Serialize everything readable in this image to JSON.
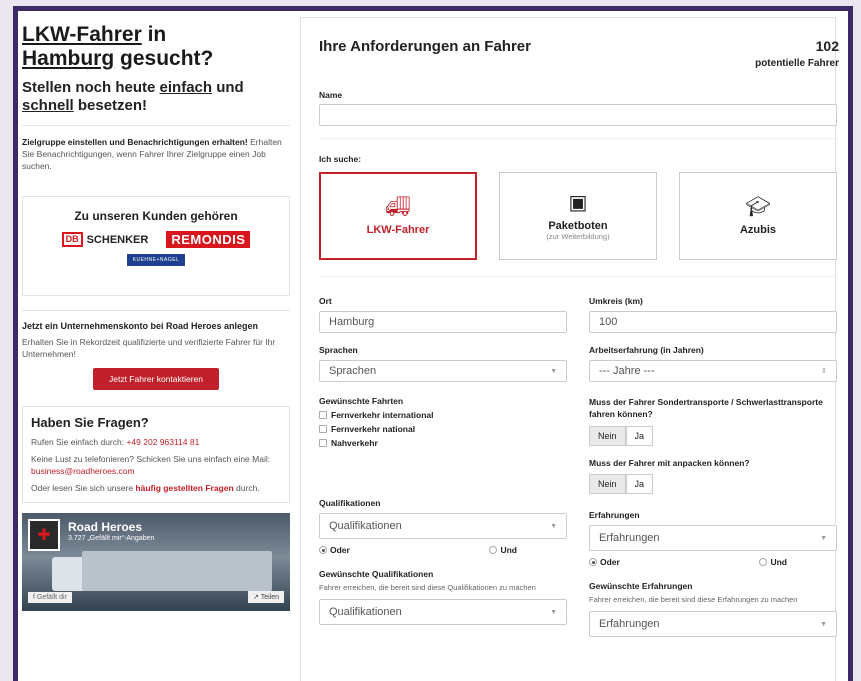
{
  "sidebar": {
    "title_part1": "LKW-Fahrer",
    "title_part2": " in",
    "title_part3": "Hamburg",
    "title_part4": " gesucht?",
    "subtitle_part1": "Stellen noch heute ",
    "subtitle_part2": "einfach",
    "subtitle_part3": " und",
    "subtitle_part4": "schnell",
    "subtitle_part5": " besetzen!",
    "notify_bold": "Zielgruppe einstellen und Benachrichtigungen erhalten!",
    "notify_text": " Erhalten Sie Benachrichtigungen, wenn Fahrer Ihrer Zielgruppe einen Job suchen.",
    "kunden_title": "Zu unseren Kunden gehören",
    "logo_db": "DB",
    "logo_schenker": "SCHENKER",
    "logo_remondis": "REMONDIS",
    "logo_kn": "KUEHNE+NAGEL",
    "cta_title": "Jetzt ein Unternehmenskonto bei Road Heroes anlegen",
    "cta_text": "Erhalten Sie in Rekordzeit qualifizierte und verifizierte Fahrer für Ihr Unternehmen!",
    "cta_button": "Jetzt Fahrer kontaktieren",
    "faq_title": "Haben Sie Fragen?",
    "faq_call": "Rufen Sie einfach durch: ",
    "faq_phone": "+49 202 963114 81",
    "faq_mail_text": "Keine Lust zu telefonieren? Schicken Sie uns einfach eine Mail: ",
    "faq_mail": "business@roadheroes.com",
    "faq_read": "Oder lesen Sie sich unsere ",
    "faq_link": "häufig gestellten Fragen",
    "faq_end": " durch.",
    "fb_name": "Road Heroes",
    "fb_likes": "3.727 „Gefällt mir“-Angaben",
    "fb_like": "Gefällt dir",
    "fb_share": "Teilen"
  },
  "form": {
    "title": "Ihre Anforderungen an Fahrer",
    "count": "102",
    "count_label": "potentielle Fahrer",
    "name_label": "Name",
    "name_value": "",
    "search_label": "Ich suche:",
    "tiles": [
      {
        "icon": "truck-icon",
        "label": "LKW-Fahrer",
        "sub": ""
      },
      {
        "icon": "boxes-icon",
        "label": "Paketboten",
        "sub": "(zur Weiterbildung)"
      },
      {
        "icon": "graduation-cap-icon",
        "label": "Azubis",
        "sub": ""
      }
    ],
    "ort_label": "Ort",
    "ort_value": "Hamburg",
    "umkreis_label": "Umkreis (km)",
    "umkreis_value": "100",
    "sprachen_label": "Sprachen",
    "sprachen_placeholder": "Sprachen",
    "erfahrung_label": "Arbeitserfahrung (in Jahren)",
    "erfahrung_value": "--- Jahre ---",
    "fahrten_label": "Gewünschte Fahrten",
    "fahrten": [
      "Fernverkehr international",
      "Fernverkehr national",
      "Nahverkehr"
    ],
    "sonder_label": "Muss der Fahrer Sondertransporte / Schwerlasttransporte fahren können?",
    "nein": "Nein",
    "ja": "Ja",
    "anpacken_label": "Muss der Fahrer mit anpacken können?",
    "quali_label": "Qualifikationen",
    "quali_placeholder": "Qualifikationen",
    "erf_label": "Erfahrungen",
    "erf_placeholder": "Erfahrungen",
    "oder": "Oder",
    "und": "Und",
    "gew_quali_label": "Gewünschte Qualifikationen",
    "gew_quali_hint": "Fahrer erreichen, die bereit sind diese Qualifikationen zu machen",
    "gew_erf_label": "Gewünschte Erfahrungen",
    "gew_erf_hint": "Fahrer erreichen, die bereit sind diese Erfahrungen zu machen"
  }
}
